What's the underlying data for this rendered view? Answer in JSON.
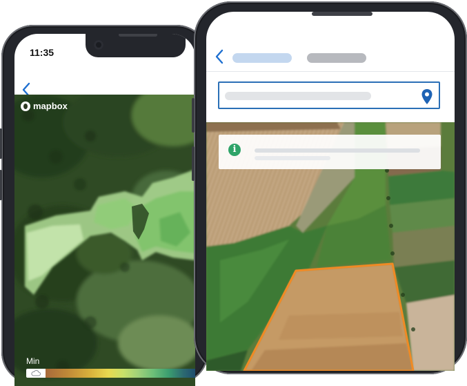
{
  "left_phone": {
    "status_time": "11:35",
    "back_glyph": "‹",
    "map": {
      "attribution_logo": "mapbox",
      "legend_min_label": "Min",
      "legend_start_icon": "cloud-icon"
    }
  },
  "right_phone": {
    "back_glyph": "‹",
    "search_icon": "location-pin-icon",
    "info_icon_glyph": "i",
    "field_outline_color": "#f08a24"
  },
  "colors": {
    "accent_blue": "#1e6fd0",
    "info_green": "#2fa469",
    "phone_frame": "#24262c"
  }
}
